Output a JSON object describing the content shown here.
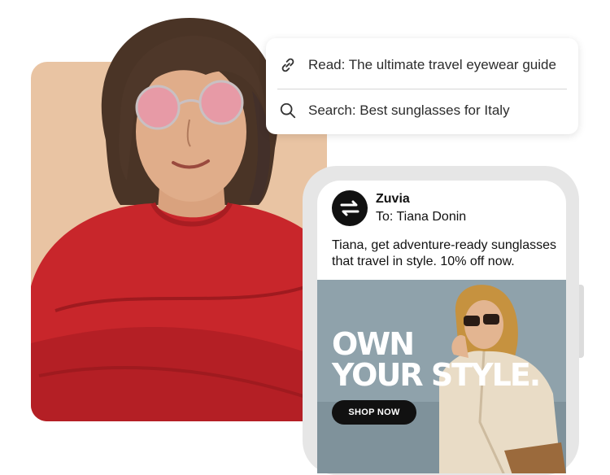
{
  "search_card": {
    "items": [
      {
        "icon": "link-icon",
        "label": "Read: The ultimate travel eyewear guide"
      },
      {
        "icon": "search-icon",
        "label": "Search: Best sunglasses for Italy"
      }
    ]
  },
  "email": {
    "sender": "Zuvia",
    "to": "To: Tiana Donin",
    "message": "Tiana, get adventure-ready sunglasses that travel in style. 10% off now.",
    "ad": {
      "headline_line1": "OWN",
      "headline_line2": "YOUR STYLE.",
      "cta": "SHOP NOW"
    }
  },
  "colors": {
    "peach_card": "#e9c4a3",
    "sweater_red": "#c8262b",
    "button_black": "#111111"
  }
}
